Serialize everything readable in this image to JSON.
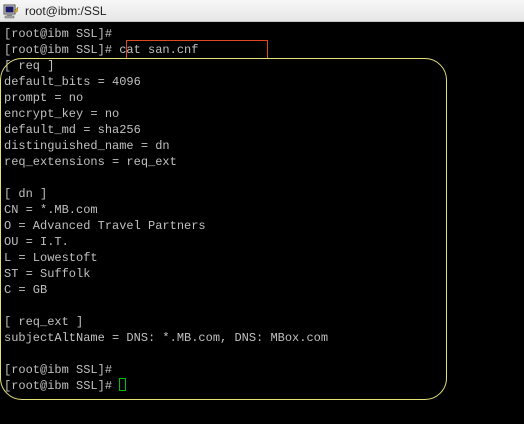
{
  "window": {
    "title": "root@ibm:/SSL"
  },
  "terminal": {
    "lines": [
      "[root@ibm SSL]#",
      "[root@ibm SSL]# cat san.cnf",
      "[ req ]",
      "default_bits = 4096",
      "prompt = no",
      "encrypt_key = no",
      "default_md = sha256",
      "distinguished_name = dn",
      "req_extensions = req_ext",
      "",
      "[ dn ]",
      "CN = *.MB.com",
      "O = Advanced Travel Partners",
      "OU = I.T.",
      "L = Lowestoft",
      "ST = Suffolk",
      "C = GB",
      "",
      "[ req_ext ]",
      "subjectAltName = DNS: *.MB.com, DNS: MBox.com",
      "",
      "[root@ibm SSL]#",
      "[root@ibm SSL]# "
    ]
  },
  "colors": {
    "background": "#000000",
    "text": "#c0c0c0",
    "cursor": "#00c000",
    "command_highlight": "#e0491f",
    "output_outline": "#e4e07a"
  },
  "icons": {
    "app": "putty-terminal-icon"
  }
}
